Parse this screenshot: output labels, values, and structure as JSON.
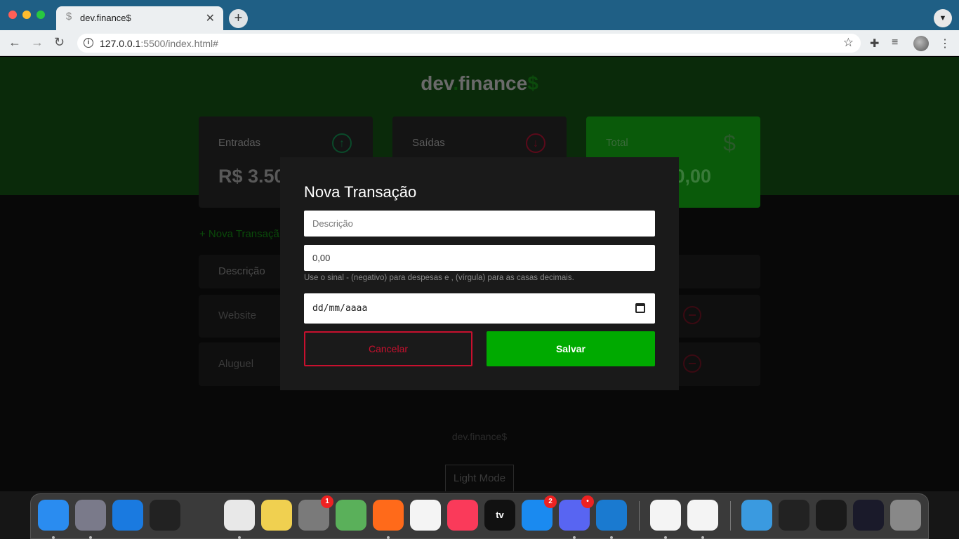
{
  "browser": {
    "tab_title": "dev.finance$",
    "tab_favicon": "$",
    "url_host": "127.0.0.1",
    "url_rest": ":5500/index.html#"
  },
  "header": {
    "logo_main": "dev",
    "logo_dot": ".",
    "logo_rest": "finance",
    "logo_dollar": "$"
  },
  "cards": {
    "entradas": {
      "label": "Entradas",
      "value": "R$ 3.50"
    },
    "saidas": {
      "label": "Saídas"
    },
    "total": {
      "label": "Total",
      "value": "0,00"
    }
  },
  "transactions": {
    "new_link": "+ Nova Transaçã",
    "header_description": "Descrição",
    "rows": [
      {
        "description": "Website"
      },
      {
        "description": "Aluguel"
      }
    ]
  },
  "footer": {
    "brand": "dev.finance$",
    "mode_button": "Light Mode"
  },
  "modal": {
    "title": "Nova Transação",
    "description_placeholder": "Descrição",
    "amount_placeholder": "0,00",
    "hint": "Use o sinal - (negativo) para despesas e , (vírgula) para as casas decimais.",
    "date_placeholder": "dd/mm/aaaa",
    "cancel_label": "Cancelar",
    "save_label": "Salvar"
  },
  "dock": {
    "items": [
      {
        "name": "Finder",
        "icon": "finder-icon",
        "color": "#2a8cf0"
      },
      {
        "name": "Launchpad",
        "icon": "rocket-icon",
        "color": "#7a7a8a"
      },
      {
        "name": "Safari",
        "icon": "safari-icon",
        "color": "#1a7ae0"
      },
      {
        "name": "Window App",
        "icon": "app-icon",
        "color": "#222222"
      },
      {
        "name": "Help",
        "icon": "question-icon",
        "color": "#3a3a3a"
      },
      {
        "name": "Chrome",
        "icon": "chrome-icon",
        "color": "#e8e8e8"
      },
      {
        "name": "Notes",
        "icon": "notes-icon",
        "color": "#f0d050"
      },
      {
        "name": "System Preferences",
        "icon": "gear-icon",
        "color": "#7a7a7a",
        "badge": "1"
      },
      {
        "name": "Maps",
        "icon": "maps-icon",
        "color": "#5ab05a"
      },
      {
        "name": "Firefox",
        "icon": "firefox-icon",
        "color": "#ff6a1a"
      },
      {
        "name": "Photos",
        "icon": "photos-icon",
        "color": "#f4f4f4"
      },
      {
        "name": "Music",
        "icon": "music-icon",
        "color": "#fa3a5a"
      },
      {
        "name": "Apple TV",
        "icon": "tv-icon",
        "color": "#111111",
        "text": "tv"
      },
      {
        "name": "App Store",
        "icon": "appstore-icon",
        "color": "#1a8af0",
        "badge": "2"
      },
      {
        "name": "Discord",
        "icon": "discord-icon",
        "color": "#5865f2",
        "badge": "•"
      },
      {
        "name": "VS Code",
        "icon": "vscode-icon",
        "color": "#1a7ad0"
      },
      {
        "name": "MongoDB Compass",
        "icon": "mongodb-icon",
        "color": "#f4f4f4"
      },
      {
        "name": "Dark Mode App",
        "icon": "moon-icon",
        "color": "#f4f4f4"
      },
      {
        "name": "Folder",
        "icon": "folder-icon",
        "color": "#3a9ae0"
      },
      {
        "name": "Window 1",
        "icon": "window-thumb-icon",
        "color": "#222222"
      },
      {
        "name": "Window 2",
        "icon": "window-thumb-icon",
        "color": "#1a1a1a"
      },
      {
        "name": "Window 3",
        "icon": "window-thumb-icon",
        "color": "#1a1a2a"
      },
      {
        "name": "Trash",
        "icon": "trash-icon",
        "color": "#888888"
      }
    ]
  }
}
